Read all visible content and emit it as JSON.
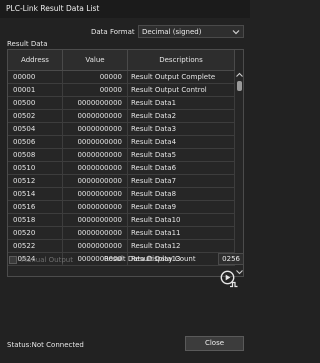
{
  "window": {
    "title": "PLC-Link Result Data List"
  },
  "format": {
    "label": "Data Format",
    "selected": "Decimal (signed)"
  },
  "result_data_label": "Result Data",
  "table": {
    "headers": {
      "address": "Address",
      "value": "Value",
      "descriptions": "Descriptions"
    },
    "rows": [
      {
        "address": "00000",
        "value": "00000",
        "description": "Result Output Complete"
      },
      {
        "address": "00001",
        "value": "00000",
        "description": "Result Output Control"
      },
      {
        "address": "00500",
        "value": "0000000000",
        "description": "Result Data1"
      },
      {
        "address": "00502",
        "value": "0000000000",
        "description": "Result Data2"
      },
      {
        "address": "00504",
        "value": "0000000000",
        "description": "Result Data3"
      },
      {
        "address": "00506",
        "value": "0000000000",
        "description": "Result Data4"
      },
      {
        "address": "00508",
        "value": "0000000000",
        "description": "Result Data5"
      },
      {
        "address": "00510",
        "value": "0000000000",
        "description": "Result Data6"
      },
      {
        "address": "00512",
        "value": "0000000000",
        "description": "Result Data7"
      },
      {
        "address": "00514",
        "value": "0000000000",
        "description": "Result Data8"
      },
      {
        "address": "00516",
        "value": "0000000000",
        "description": "Result Data9"
      },
      {
        "address": "00518",
        "value": "0000000000",
        "description": "Result Data10"
      },
      {
        "address": "00520",
        "value": "0000000000",
        "description": "Result Data11"
      },
      {
        "address": "00522",
        "value": "0000000000",
        "description": "Result Data12"
      },
      {
        "address": "00524",
        "value": "0000000000",
        "description": "Result Data13"
      }
    ]
  },
  "manual_output": {
    "label": "Manual Output",
    "checked": false,
    "enabled": false
  },
  "display_count": {
    "label": "Result Data Display Count",
    "value": "0256"
  },
  "status": {
    "text": "Status:Not Connected"
  },
  "buttons": {
    "close": "Close"
  },
  "icons": {
    "dropdown": "chevron-down-icon",
    "scroll_up": "arrow-up-icon",
    "scroll_down": "arrow-down-icon",
    "play": "play-step-icon"
  },
  "colors": {
    "background": "#222222",
    "titlebar": "#1b1b1b",
    "grid_line": "#3d3d3d",
    "disabled_text": "#6e6e6e"
  }
}
